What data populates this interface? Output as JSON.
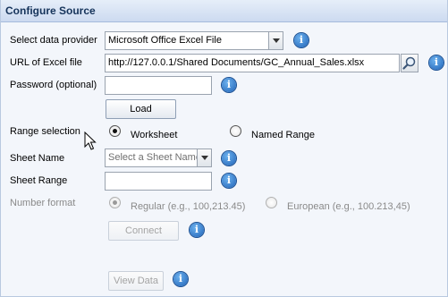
{
  "header": {
    "title": "Configure Source"
  },
  "form": {
    "provider": {
      "label": "Select data provider",
      "value": "Microsoft Office Excel File"
    },
    "url": {
      "label": "URL of Excel file",
      "value": "http://127.0.0.1/Shared Documents/GC_Annual_Sales.xlsx"
    },
    "password": {
      "label": "Password (optional)",
      "value": ""
    },
    "load_button": "Load",
    "range": {
      "label": "Range selection",
      "option_worksheet": "Worksheet",
      "option_named": "Named Range",
      "selected": "Worksheet"
    },
    "sheet_name": {
      "label": "Sheet Name",
      "placeholder": "Select a Sheet Name"
    },
    "sheet_range": {
      "label": "Sheet Range",
      "value": ""
    },
    "number_format": {
      "label": "Number format",
      "option_regular": "Regular (e.g., 100,213.45)",
      "option_european": "European (e.g., 100.213,45)",
      "selected": "Regular"
    },
    "connect_button": "Connect",
    "view_data_button": "View Data"
  },
  "icons": {
    "info": "info-icon",
    "info_glyph": "i",
    "search": "magnifier-icon",
    "cursor": "mouse-pointer-icon"
  },
  "colors": {
    "header_text": "#15335a",
    "info_blue": "#1f62b7",
    "panel_bg": "#f3f6fb"
  }
}
